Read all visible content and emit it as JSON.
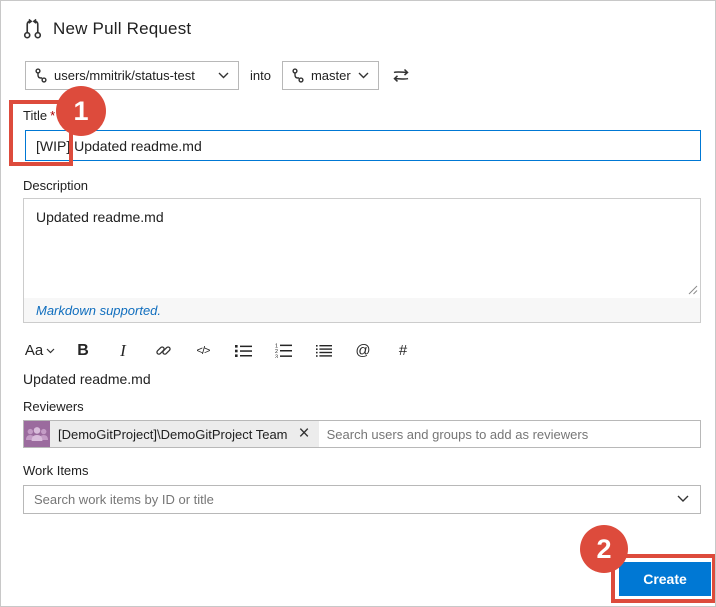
{
  "header": {
    "title": "New Pull Request"
  },
  "branches": {
    "source": "users/mmitrik/status-test",
    "into_label": "into",
    "target": "master"
  },
  "title_field": {
    "label": "Title",
    "required_marker": "*",
    "value": "[WIP] Updated readme.md"
  },
  "description_field": {
    "label": "Description",
    "value": "Updated readme.md",
    "footer_note": "Markdown supported."
  },
  "toolbar": {
    "format_label": "Aa",
    "bold_label": "B",
    "italic_label": "I",
    "code_label": "</>",
    "mention_label": "@",
    "work_item_label": "#",
    "icons": [
      "text-format-dropdown",
      "bold",
      "italic",
      "link",
      "code",
      "bullet-list",
      "numbered-list",
      "task-list",
      "mention",
      "work-item"
    ]
  },
  "preview": {
    "text": "Updated readme.md"
  },
  "reviewers": {
    "label": "Reviewers",
    "chip_name": "[DemoGitProject]\\DemoGitProject Team",
    "remove_icon": "×",
    "placeholder": "Search users and groups to add as reviewers"
  },
  "work_items": {
    "label": "Work Items",
    "placeholder": "Search work items by ID or title"
  },
  "create_button": {
    "label": "Create"
  },
  "annotations": {
    "step1": "1",
    "step2": "2"
  },
  "colors": {
    "accent_blue": "#0078d4",
    "annotation_red": "#dd4b3c",
    "link_blue": "#106ebe",
    "avatar_purple": "#9b6b9e",
    "avatar_figure": "#cfaed0",
    "border_gray": "#b8b8b8"
  }
}
